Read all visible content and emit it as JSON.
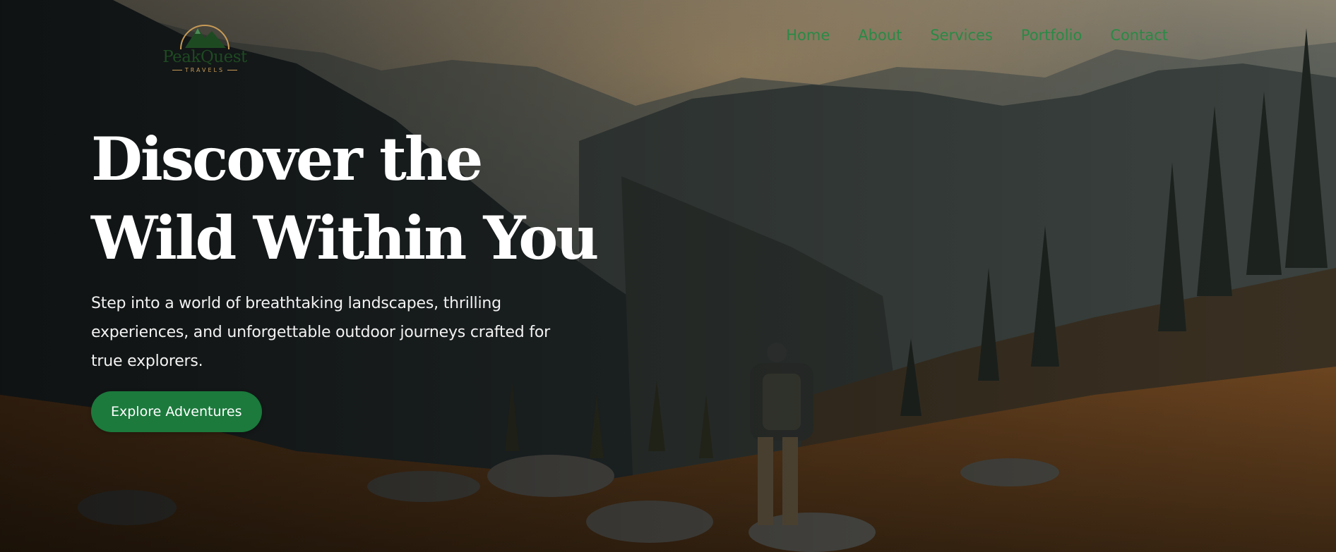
{
  "brand": {
    "logo_name": "PeakQuest",
    "logo_tagline": "TRAVELS",
    "primary_color": "#1b7a3c",
    "nav_color": "#2a8a46",
    "accent_color": "#c79a56"
  },
  "nav": {
    "items": [
      {
        "label": "Home"
      },
      {
        "label": "About"
      },
      {
        "label": "Services"
      },
      {
        "label": "Portfolio"
      },
      {
        "label": "Contact"
      }
    ]
  },
  "hero": {
    "headline_line1": "Discover the",
    "headline_line2": "Wild Within You",
    "subtext": "Step into a world of breathtaking landscapes, thrilling experiences, and unforgettable outdoor journeys crafted for true explorers.",
    "cta_label": "Explore Adventures",
    "background": "mountain-valley-hiker-photo"
  }
}
